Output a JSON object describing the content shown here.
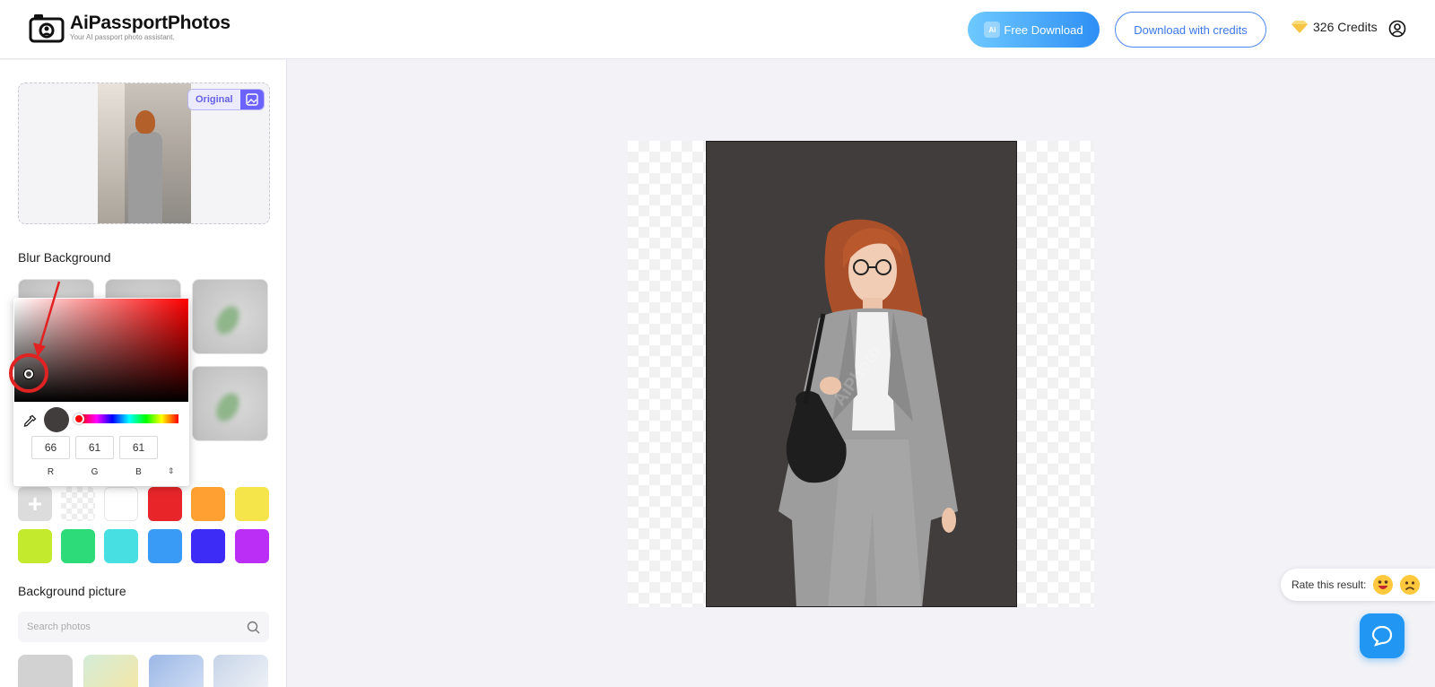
{
  "header": {
    "logo_title": "AiPassportPhotos",
    "logo_tagline": "Your AI passport photo assistant.",
    "free_download_label": "Free Download",
    "free_download_badge": "AI",
    "download_credits_label": "Download with credits",
    "credits_text": "326 Credits"
  },
  "sidebar": {
    "original_badge": "Original",
    "blur_title": "Blur Background",
    "background_picture_title": "Background picture",
    "search_placeholder": "Search photos",
    "swatch_add_symbol": "+",
    "swatches": [
      {
        "name": "add",
        "color": "#dcdcdc"
      },
      {
        "name": "transparent",
        "color": "transparent"
      },
      {
        "name": "white",
        "color": "#ffffff"
      },
      {
        "name": "red",
        "color": "#e8262a"
      },
      {
        "name": "orange",
        "color": "#ffa132"
      },
      {
        "name": "yellow",
        "color": "#f6e44b"
      },
      {
        "name": "lime",
        "color": "#c3ea2c"
      },
      {
        "name": "green",
        "color": "#2edb79"
      },
      {
        "name": "cyan",
        "color": "#47dfe1"
      },
      {
        "name": "blue",
        "color": "#3a9bf7"
      },
      {
        "name": "indigo",
        "color": "#3d2cf5"
      },
      {
        "name": "purple",
        "color": "#bb2ef6"
      }
    ]
  },
  "color_picker": {
    "r": "66",
    "g": "61",
    "b": "61",
    "r_label": "R",
    "g_label": "G",
    "b_label": "B",
    "toggle_symbol": "⇕",
    "selected_color": "#423d3d"
  },
  "canvas": {
    "background_color": "#423d3d",
    "watermark": "AiPhoto"
  },
  "rate": {
    "label": "Rate this result:"
  },
  "colors": {
    "accent_blue": "#3b78e7",
    "annotation_red": "#e12222"
  }
}
